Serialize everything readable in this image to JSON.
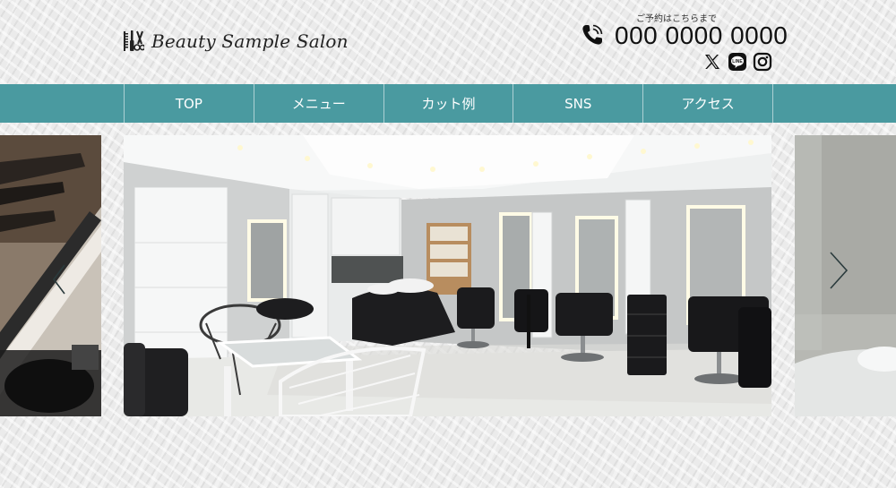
{
  "header": {
    "logo_text": "Beauty Sample Salon",
    "reserve_label": "ご予約はこちらまで",
    "phone_number": "000 0000 0000",
    "icons": [
      "barber-tools-icon",
      "phone-icon",
      "x-icon",
      "line-icon",
      "instagram-icon"
    ]
  },
  "nav": {
    "items": [
      {
        "label": "TOP"
      },
      {
        "label": "メニュー"
      },
      {
        "label": "カット例"
      },
      {
        "label": "SNS"
      },
      {
        "label": "アクセス"
      }
    ]
  },
  "slider": {
    "slides": [
      "makeup-brush-closeup",
      "salon-interior",
      "salon-basin-closeup"
    ],
    "arrows": [
      "chevron-left-icon",
      "chevron-right-icon"
    ]
  },
  "colors": {
    "nav_background": "#4a9aa0",
    "nav_text": "#ffffff",
    "text_dark": "#111111",
    "page_background": "#ebebeb"
  }
}
